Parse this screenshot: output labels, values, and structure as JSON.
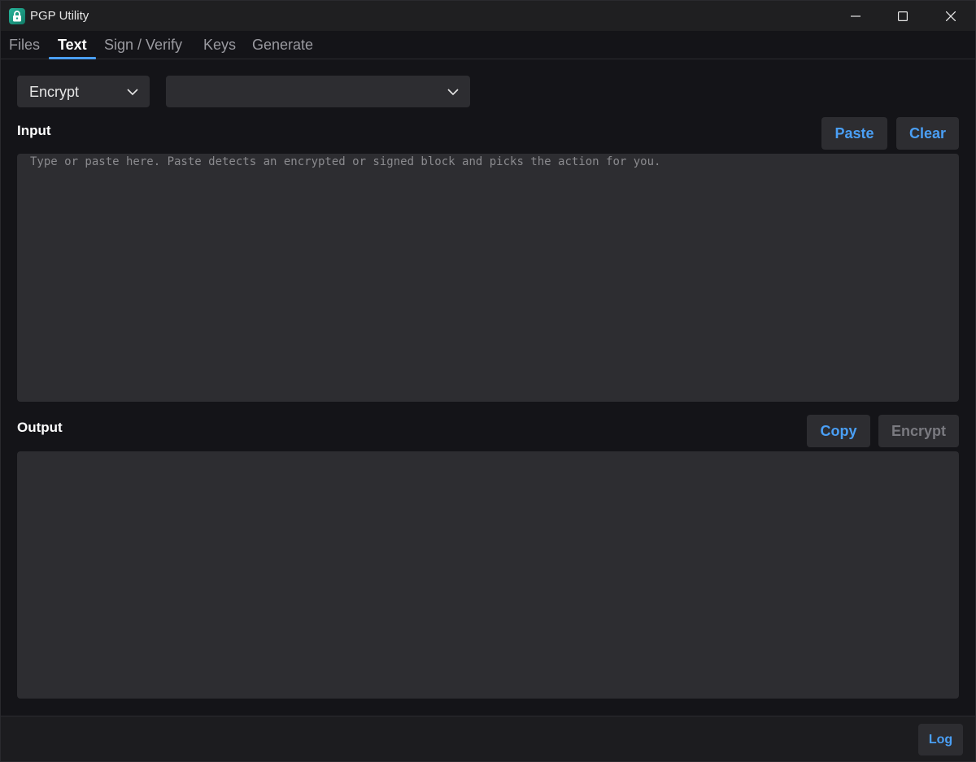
{
  "window": {
    "title": "PGP Utility"
  },
  "tabs": [
    {
      "label": "Files",
      "active": false
    },
    {
      "label": "Text",
      "active": true
    },
    {
      "label": "Sign / Verify",
      "active": false
    },
    {
      "label": "Keys",
      "active": false
    },
    {
      "label": "Generate",
      "active": false
    }
  ],
  "toolbar": {
    "mode_select": {
      "value": "Encrypt"
    },
    "key_select": {
      "value": ""
    }
  },
  "input": {
    "label": "Input",
    "paste_label": "Paste",
    "clear_label": "Clear",
    "value": "",
    "placeholder": "Type or paste here. Paste detects an encrypted or signed block and picks the action for you."
  },
  "output": {
    "label": "Output",
    "copy_label": "Copy",
    "action_label": "Encrypt",
    "action_enabled": false,
    "value": ""
  },
  "footer": {
    "log_label": "Log"
  },
  "colors": {
    "accent": "#4a9ff5",
    "background": "#141418",
    "surface": "#2d2d31",
    "titlebar": "#1f1f21",
    "app_icon": "#1f9d86"
  },
  "icons": {
    "app": "lock-icon",
    "minimize": "minimize-icon",
    "maximize": "maximize-icon",
    "close": "close-icon",
    "dropdown": "chevron-down-icon"
  }
}
